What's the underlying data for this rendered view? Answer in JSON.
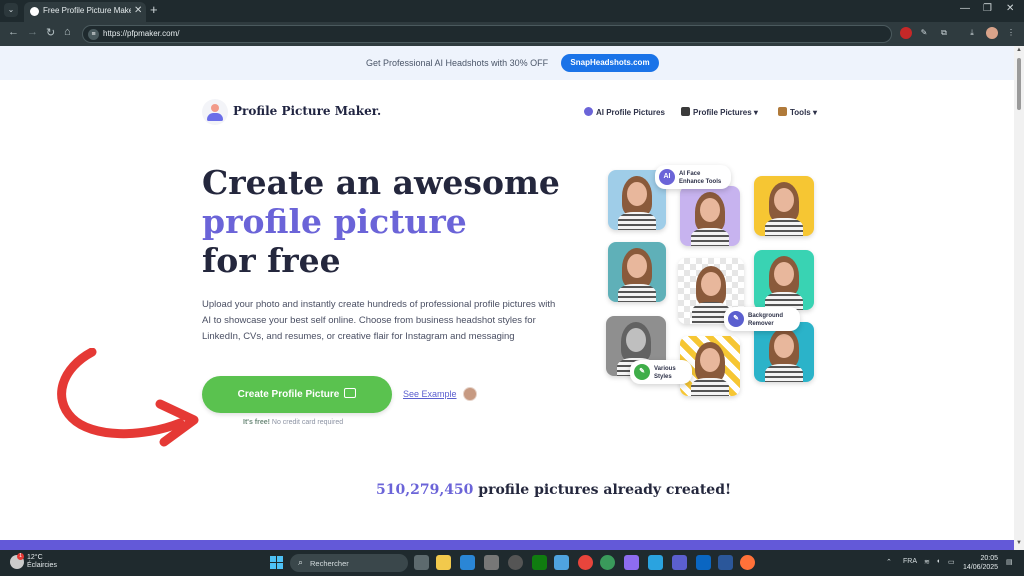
{
  "browser": {
    "tab_dropdown": "⌄",
    "tab_title": "Free Profile Picture Maker - Gen",
    "url": "https://pfpmaker.com/",
    "new_tab": "+"
  },
  "promo": {
    "text": "Get Professional AI Headshots with 30% OFF",
    "button": "SnapHeadshots.com"
  },
  "header": {
    "brand": "Profile Picture Maker.",
    "nav": [
      {
        "label": "AI Profile Pictures",
        "icon": "ai-icon"
      },
      {
        "label": "Profile Pictures",
        "icon": "photo-icon",
        "dropdown": "▾"
      },
      {
        "label": "Tools",
        "icon": "tools-icon",
        "dropdown": "▾"
      }
    ]
  },
  "hero": {
    "title_line1": "Create an awesome",
    "title_line2": "profile picture",
    "title_line3": "for free",
    "description": "Upload your photo and instantly create hundreds of professional profile pictures with AI to showcase your best self online. Choose from business headshot styles for LinkedIn, CVs, and resumes, or creative flair for Instagram and messaging",
    "cta": "Create Profile Picture",
    "see_example": "See Example",
    "free_bold": "It's free!",
    "free_rest": "No credit card required"
  },
  "collage": {
    "badge_ai_icon": "AI",
    "badge_ai": "AI Face Enhance Tools",
    "badge_bg": "Background Remover",
    "badge_styles": "Various Styles"
  },
  "counter": {
    "number": "510,279,450",
    "text": "profile pictures already created!"
  },
  "taskbar": {
    "temp": "12°C",
    "weather": "Éclaircies",
    "weather_badge": "1",
    "search": "Rechercher",
    "lang": "FRA",
    "time": "20:05",
    "date": "14/06/2025"
  },
  "colors": {
    "accent": "#6b64d8",
    "cta_green": "#5ac24f",
    "promo_blue": "#1a73e8",
    "arrow_red": "#e53935"
  }
}
